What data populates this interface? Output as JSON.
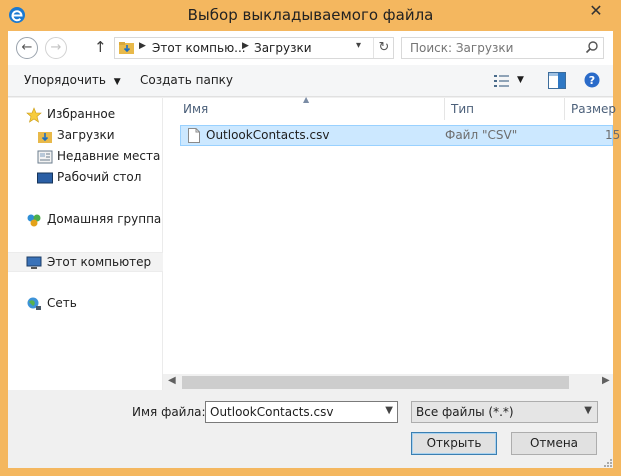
{
  "window": {
    "title": "Выбор выкладываемого файла",
    "close_glyph": "✕",
    "app_icon": "edge-e-icon",
    "accent_color": "#f4b75f"
  },
  "addressbar": {
    "back_glyph": "←",
    "forward_glyph": "→",
    "up_glyph": "↑",
    "path": [
      "Этот компью...",
      "Загрузки"
    ],
    "refresh_glyph": "↻",
    "dropdown_glyph": "⌄"
  },
  "search": {
    "placeholder": "Поиск: Загрузки"
  },
  "toolbar": {
    "organize_label": "Упорядочить",
    "new_folder_label": "Создать папку"
  },
  "nav": {
    "favorites": "Избранное",
    "downloads": "Загрузки",
    "recent": "Недавние места",
    "desktop": "Рабочий стол",
    "homegroup": "Домашняя группа",
    "computer": "Этот компьютер",
    "network": "Сеть"
  },
  "columns": {
    "name": "Имя",
    "type": "Тип",
    "size": "Размер"
  },
  "files": [
    {
      "name": "OutlookContacts.csv",
      "type": "Файл \"CSV\"",
      "size": "15"
    }
  ],
  "bottom": {
    "filename_label": "Имя файла:",
    "filename_value": "OutlookContacts.csv",
    "filter_value": "Все файлы (*.*)",
    "open_label": "Открыть",
    "cancel_label": "Отмена"
  },
  "colors": {
    "selection_bg": "#cce8ff",
    "selection_border": "#99d1ff",
    "header_text": "#4c607a"
  }
}
